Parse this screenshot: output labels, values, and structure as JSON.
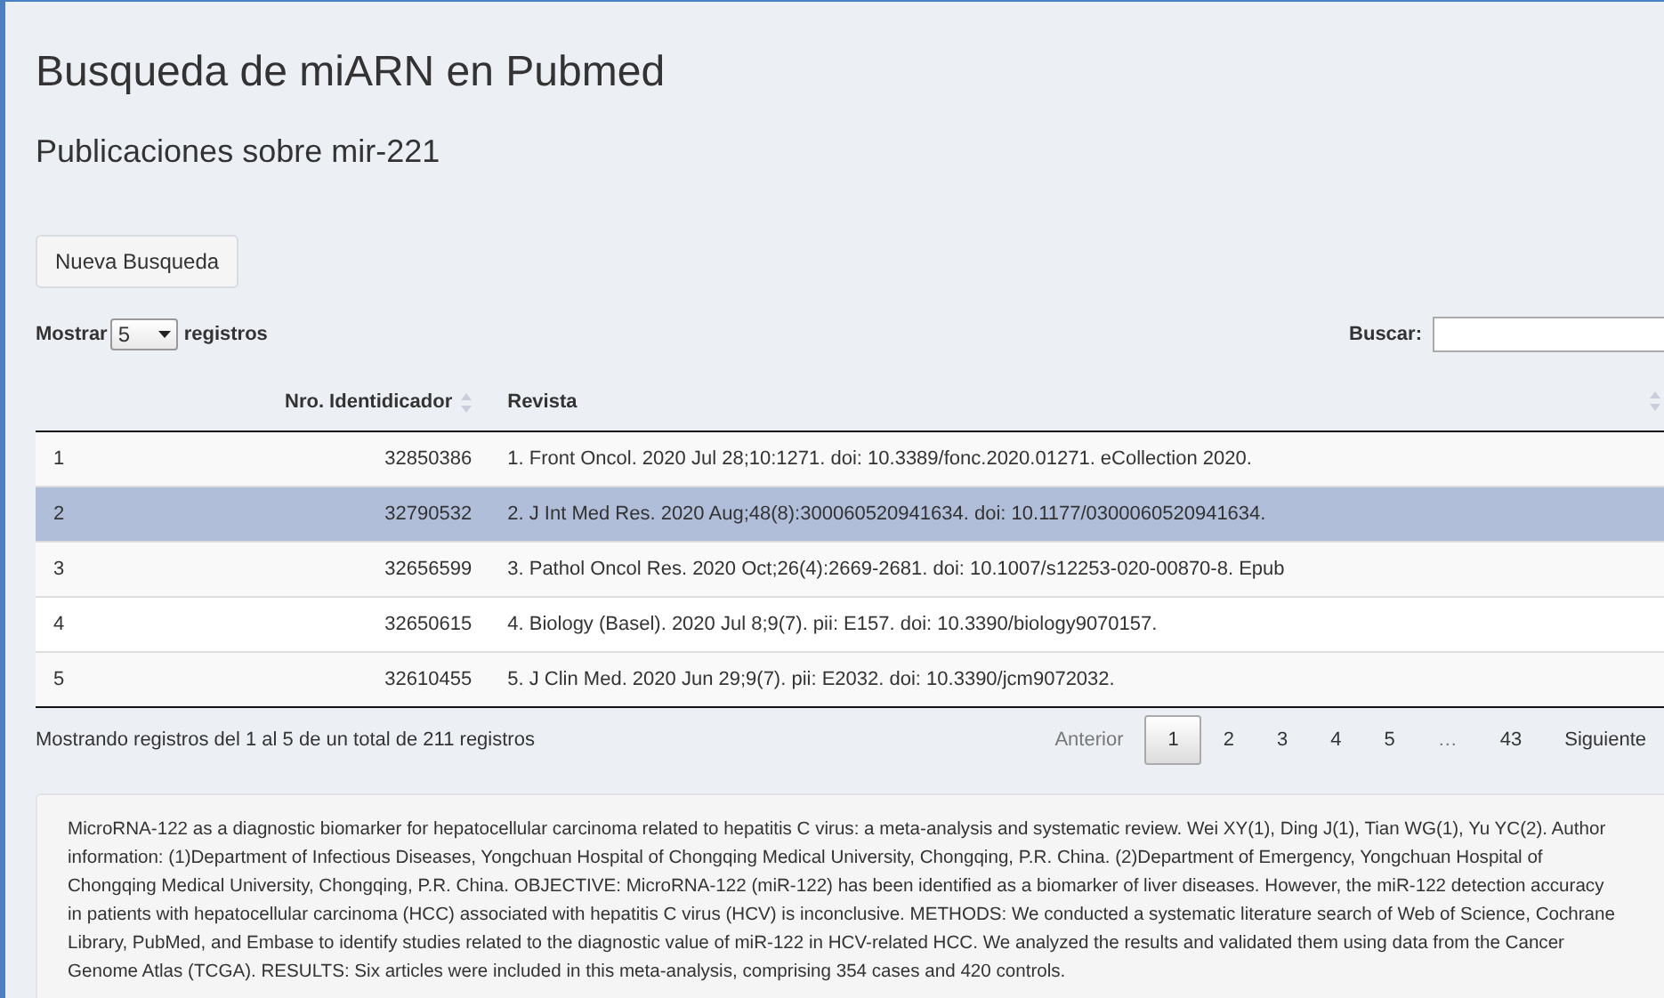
{
  "page": {
    "title": "Busqueda de miARN en Pubmed",
    "subtitle": "Publicaciones sobre mir-221"
  },
  "new_search_button": "Nueva Busqueda",
  "length_control": {
    "label_before": "Mostrar",
    "value": "5",
    "label_after": "registros"
  },
  "search": {
    "label": "Buscar:"
  },
  "table": {
    "columns": [
      "",
      "Nro. Identidicador",
      "Revista"
    ],
    "rows": [
      {
        "cells": [
          "1",
          "32850386",
          "1. Front Oncol. 2020 Jul 28;10:1271. doi: 10.3389/fonc.2020.01271. eCollection 2020."
        ],
        "selected": false
      },
      {
        "cells": [
          "2",
          "32790532",
          "2. J Int Med Res. 2020 Aug;48(8):300060520941634. doi: 10.1177/0300060520941634."
        ],
        "selected": true
      },
      {
        "cells": [
          "3",
          "32656599",
          "3. Pathol Oncol Res. 2020 Oct;26(4):2669-2681. doi: 10.1007/s12253-020-00870-8. Epub"
        ],
        "selected": false
      },
      {
        "cells": [
          "4",
          "32650615",
          "4. Biology (Basel). 2020 Jul 8;9(7). pii: E157. doi: 10.3390/biology9070157."
        ],
        "selected": false
      },
      {
        "cells": [
          "5",
          "32610455",
          "5. J Clin Med. 2020 Jun 29;9(7). pii: E2032. doi: 10.3390/jcm9072032."
        ],
        "selected": false
      }
    ]
  },
  "info": "Mostrando registros del 1 al 5 de un total de 211 registros",
  "pagination": {
    "previous": "Anterior",
    "next": "Siguiente",
    "pages": [
      {
        "label": "1",
        "kind": "page",
        "selected": true
      },
      {
        "label": "2",
        "kind": "page",
        "selected": false
      },
      {
        "label": "3",
        "kind": "page",
        "selected": false
      },
      {
        "label": "4",
        "kind": "page",
        "selected": false
      },
      {
        "label": "5",
        "kind": "page",
        "selected": false
      },
      {
        "label": "…",
        "kind": "ellipsis"
      },
      {
        "label": "43",
        "kind": "page",
        "selected": false
      }
    ]
  },
  "abstract": "MicroRNA-122 as a diagnostic biomarker for hepatocellular carcinoma related to hepatitis C virus: a meta-analysis and systematic review. Wei XY(1), Ding J(1), Tian WG(1), Yu YC(2). Author information: (1)Department of Infectious Diseases, Yongchuan Hospital of Chongqing Medical University, Chongqing, P.R. China. (2)Department of Emergency, Yongchuan Hospital of Chongqing Medical University, Chongqing, P.R. China. OBJECTIVE: MicroRNA-122 (miR-122) has been identified as a biomarker of liver diseases. However, the miR-122 detection accuracy in patients with hepatocellular carcinoma (HCC) associated with hepatitis C virus (HCV) is inconclusive. METHODS: We conducted a systematic literature search of Web of Science, Cochrane Library, PubMed, and Embase to identify studies related to the diagnostic value of miR-122 in HCV-related HCC. We analyzed the results and validated them using data from the Cancer Genome Atlas (TCGA). RESULTS: Six articles were included in this meta-analysis, comprising 354 cases and 420 controls."
}
